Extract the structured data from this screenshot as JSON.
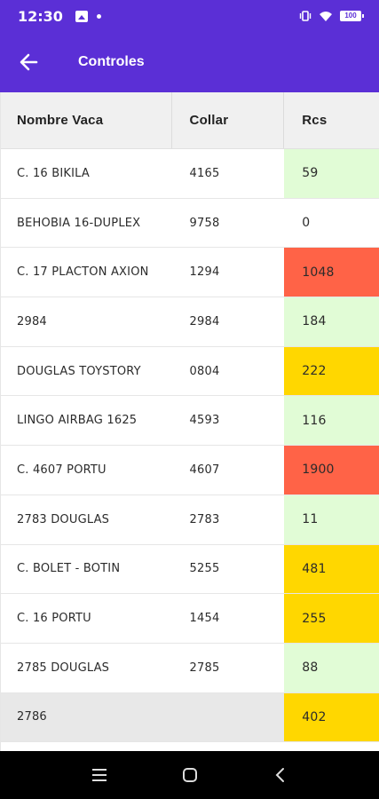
{
  "status_bar": {
    "time": "12:30",
    "battery": "100"
  },
  "app_bar": {
    "title": "Controles"
  },
  "table": {
    "headers": [
      "Nombre Vaca",
      "Collar",
      "Rcs"
    ],
    "rows": [
      {
        "name": "C. 16 BIKILA",
        "collar": "4165",
        "rcs": "59",
        "level": "low"
      },
      {
        "name": "BEHOBIA 16-DUPLEX",
        "collar": "9758",
        "rcs": "0",
        "level": "none"
      },
      {
        "name": "C. 17 PLACTON AXION",
        "collar": "1294",
        "rcs": "1048",
        "level": "high"
      },
      {
        "name": "2984",
        "collar": "2984",
        "rcs": "184",
        "level": "low"
      },
      {
        "name": "DOUGLAS TOYSTORY",
        "collar": "0804",
        "rcs": "222",
        "level": "mid"
      },
      {
        "name": "LINGO AIRBAG 1625",
        "collar": "4593",
        "rcs": "116",
        "level": "low"
      },
      {
        "name": "C. 4607 PORTU",
        "collar": "4607",
        "rcs": "1900",
        "level": "high"
      },
      {
        "name": "2783 DOUGLAS",
        "collar": "2783",
        "rcs": "11",
        "level": "low"
      },
      {
        "name": "C. BOLET - BOTIN",
        "collar": "5255",
        "rcs": "481",
        "level": "mid"
      },
      {
        "name": "C. 16 PORTU",
        "collar": "1454",
        "rcs": "255",
        "level": "mid"
      },
      {
        "name": "2785 DOUGLAS",
        "collar": "2785",
        "rcs": "88",
        "level": "low"
      },
      {
        "name": "2786",
        "collar": "",
        "rcs": "402",
        "level": "mid",
        "highlighted": true
      }
    ]
  },
  "colors": {
    "primary": "#5b2fd6",
    "low": "#e1fcd6",
    "mid": "#ffd700",
    "high": "#ff6347",
    "none": "#ffffff",
    "row_highlight": "#e8e8e8"
  },
  "icons": {
    "back": "arrow-left-icon",
    "nav_recent": "menu-icon",
    "nav_home": "home-icon",
    "nav_back": "chevron-left-icon"
  }
}
